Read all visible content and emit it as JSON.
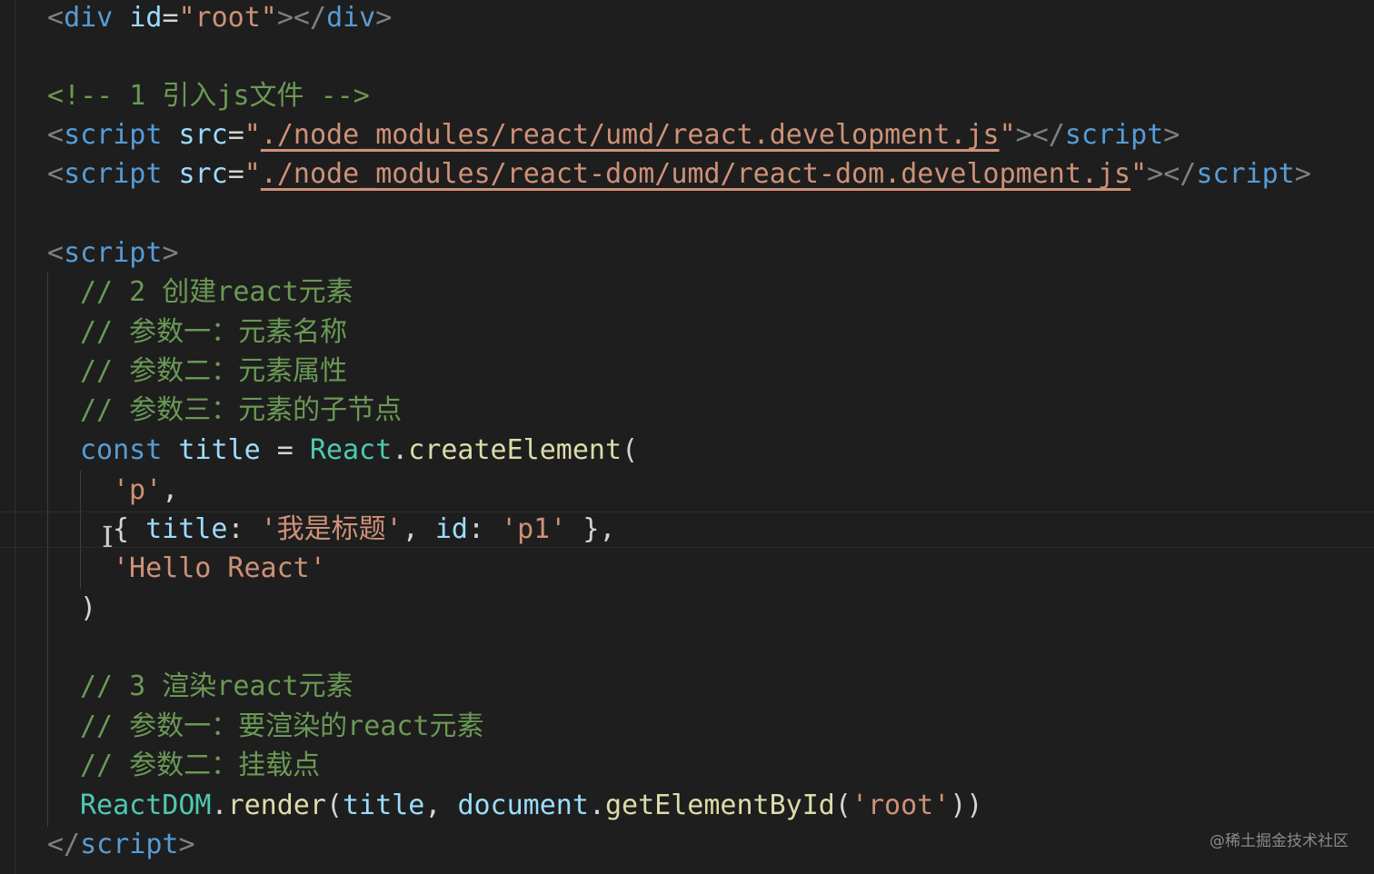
{
  "editor": {
    "line1": {
      "open_bracket": "<",
      "tag": "div",
      "attr": "id",
      "eq": "=",
      "value": "\"root\"",
      "close": "></",
      "close_tag": "div",
      "end": ">"
    },
    "line3": {
      "comment": "<!-- 1 引入js文件 -->"
    },
    "line4": {
      "open": "<",
      "tag": "script",
      "attr": "src",
      "eq": "=",
      "q1": "\"",
      "path": "./node_modules/react/umd/react.development.js",
      "q2": "\"",
      "close": "></",
      "close_tag": "script",
      "end": ">"
    },
    "line5": {
      "open": "<",
      "tag": "script",
      "attr": "src",
      "eq": "=",
      "q1": "\"",
      "path": "./node_modules/react-dom/umd/react-dom.development.js",
      "q2": "\"",
      "close": "></",
      "close_tag": "script",
      "end": ">"
    },
    "line7": {
      "open": "<",
      "tag": "script",
      "end": ">"
    },
    "comments_a": [
      "// 2 创建react元素",
      "// 参数一：元素名称",
      "// 参数二：元素属性",
      "// 参数三：元素的子节点"
    ],
    "line12": {
      "keyword": "const",
      "var": "title",
      "eq": " = ",
      "obj": "React",
      "dot": ".",
      "fn": "createElement",
      "paren": "("
    },
    "line13": {
      "str": "'p'",
      "comma": ","
    },
    "line14": {
      "brace_open": "{ ",
      "key1": "title",
      "colon1": ": ",
      "val1": "'我是标题'",
      "sep": ", ",
      "key2": "id",
      "colon2": ": ",
      "val2": "'p1'",
      "brace_close": " },"
    },
    "line15": {
      "str": "'Hello React'"
    },
    "line16": {
      "paren": ")"
    },
    "comments_b": [
      "// 3 渲染react元素",
      "// 参数一：要渲染的react元素",
      "// 参数二：挂载点"
    ],
    "line21": {
      "obj": "ReactDOM",
      "dot": ".",
      "fn": "render",
      "open": "(",
      "arg1": "title",
      "sep": ", ",
      "obj2": "document",
      "dot2": ".",
      "fn2": "getElementById",
      "open2": "(",
      "str": "'root'",
      "close": "))"
    },
    "line22": {
      "open": "</",
      "tag": "script",
      "end": ">"
    }
  },
  "cursor_glyph": "I",
  "watermark": "@稀土掘金技术社区",
  "colors": {
    "background": "#1e1e1e",
    "tag": "#569cd6",
    "attribute": "#9cdcfe",
    "string": "#ce9178",
    "comment": "#6a9955",
    "function": "#dcdcaa",
    "class": "#4ec9b0"
  }
}
